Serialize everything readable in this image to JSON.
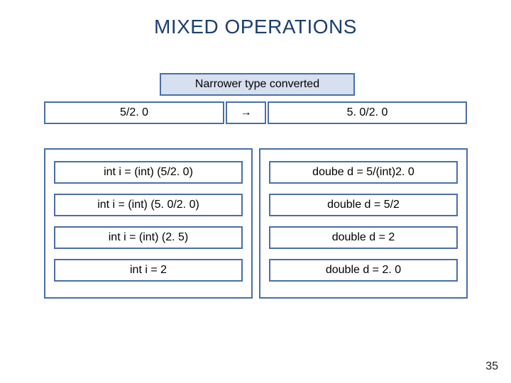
{
  "title": "MIXED OPERATIONS",
  "narrower_label": "Narrower type converted",
  "row2": {
    "left": "5/2. 0",
    "arrow": "→",
    "right": "5. 0/2. 0"
  },
  "left_col": [
    "int i = (int) (5/2. 0)",
    "int i = (int) (5. 0/2. 0)",
    "int i = (int) (2. 5)",
    "int i = 2"
  ],
  "right_col": [
    "doube d = 5/(int)2. 0",
    "double d = 5/2",
    "double d = 2",
    "double d = 2. 0"
  ],
  "page_number": "35"
}
